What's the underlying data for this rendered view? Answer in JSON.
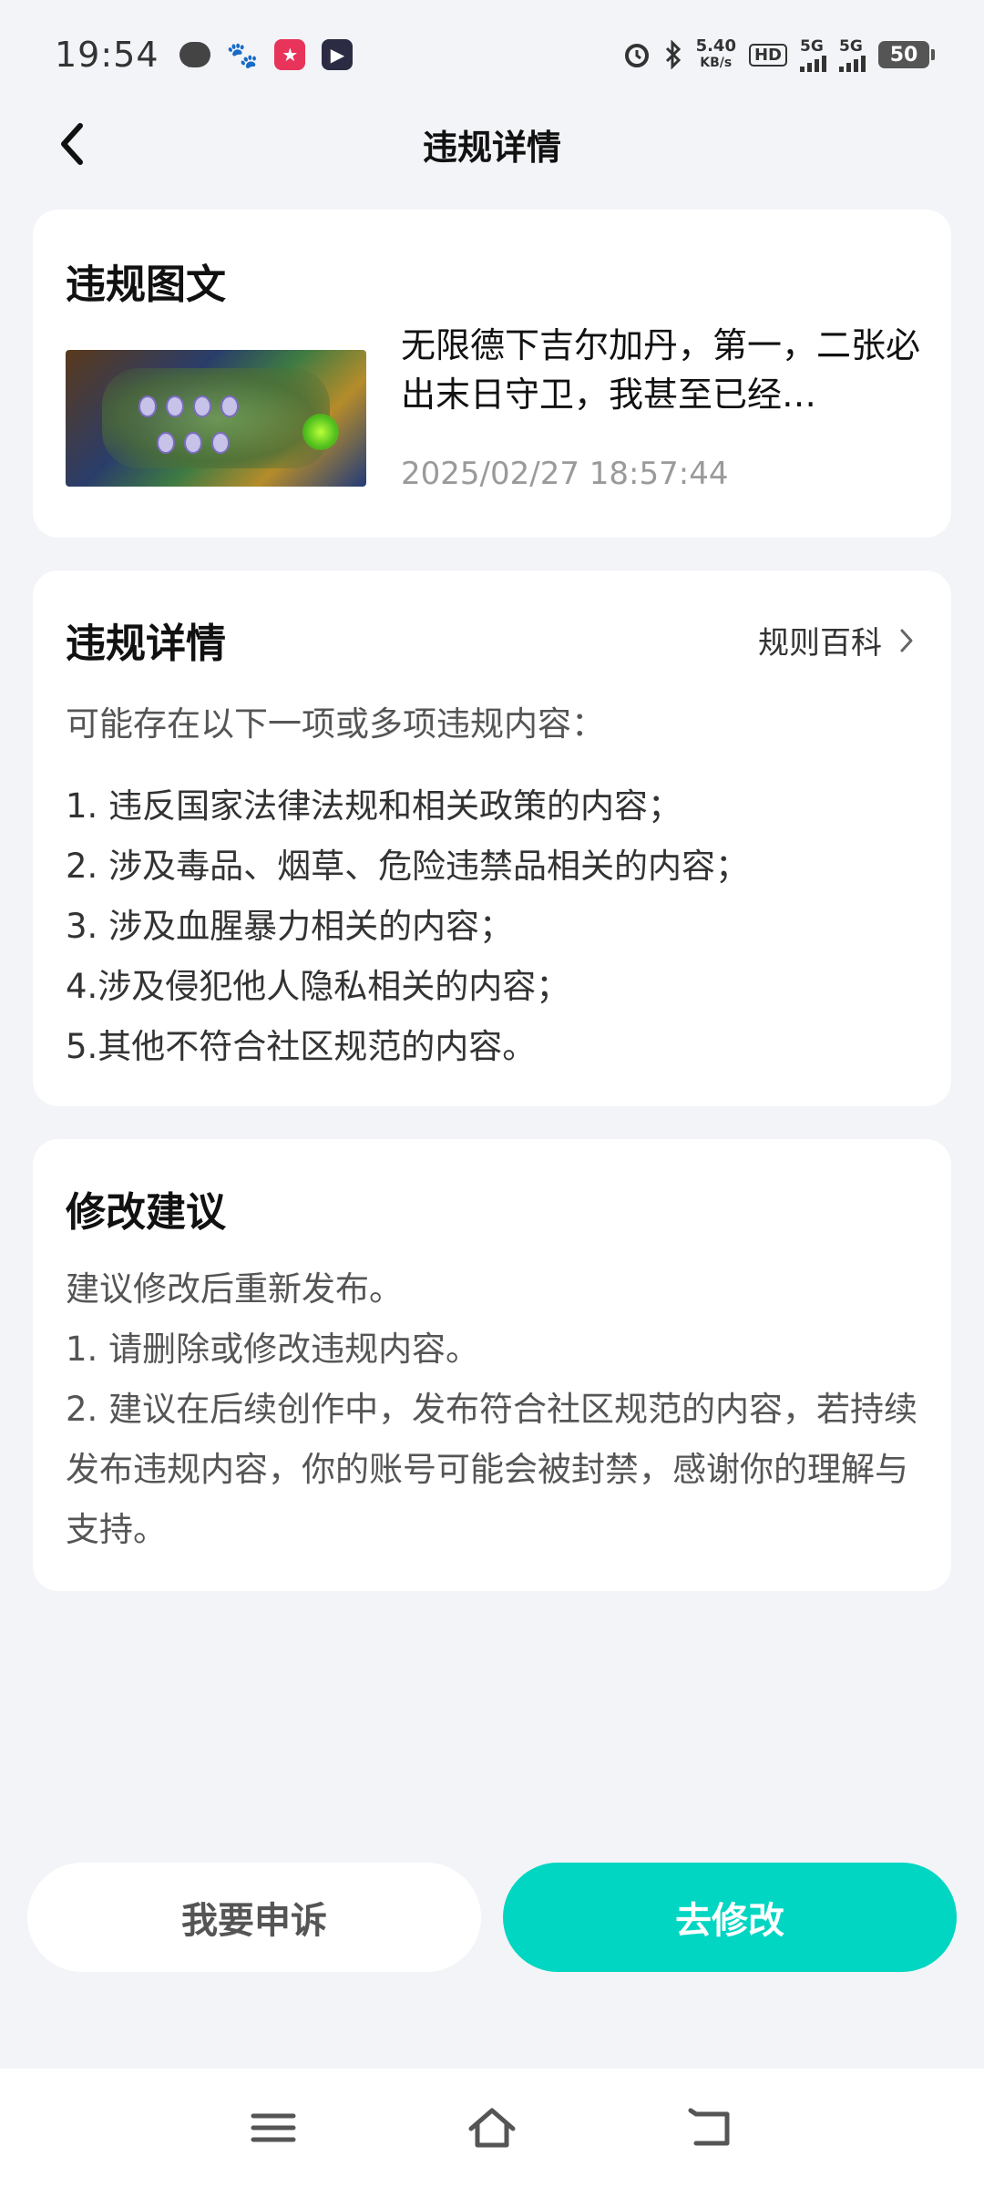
{
  "status_bar": {
    "time": "19:54",
    "network_speed_value": "5.40",
    "network_speed_unit": "KB/s",
    "hd_label": "HD",
    "sim1_label": "5G",
    "sim2_label": "5G",
    "battery_level": "50",
    "icons": [
      "chat-icon",
      "baidu-paw-icon",
      "app-icon-red",
      "app-icon-dark",
      "alarm-icon",
      "bluetooth-icon"
    ]
  },
  "header": {
    "title": "违规详情"
  },
  "violation_post": {
    "section_title": "违规图文",
    "text": "无限德下吉尔加丹，第一，二张必出末日守卫，我甚至已经…",
    "timestamp": "2025/02/27 18:57:44"
  },
  "violation_details": {
    "section_title": "违规详情",
    "rules_link": "规则百科",
    "intro": "可能存在以下一项或多项违规内容：",
    "items": [
      "1. 违反国家法律法规和相关政策的内容；",
      "2. 涉及毒品、烟草、危险违禁品相关的内容；",
      "3. 涉及血腥暴力相关的内容；",
      "4.涉及侵犯他人隐私相关的内容；",
      "5.其他不符合社区规范的内容。"
    ]
  },
  "suggestions": {
    "section_title": "修改建议",
    "lines": [
      "建议修改后重新发布。",
      "1. 请删除或修改违规内容。",
      "2. 建议在后续创作中，发布符合社区规范的内容，若持续发布违规内容，你的账号可能会被封禁，感谢你的理解与支持。"
    ]
  },
  "actions": {
    "appeal_label": "我要申诉",
    "modify_label": "去修改",
    "accent_color": "#00d6c2"
  }
}
